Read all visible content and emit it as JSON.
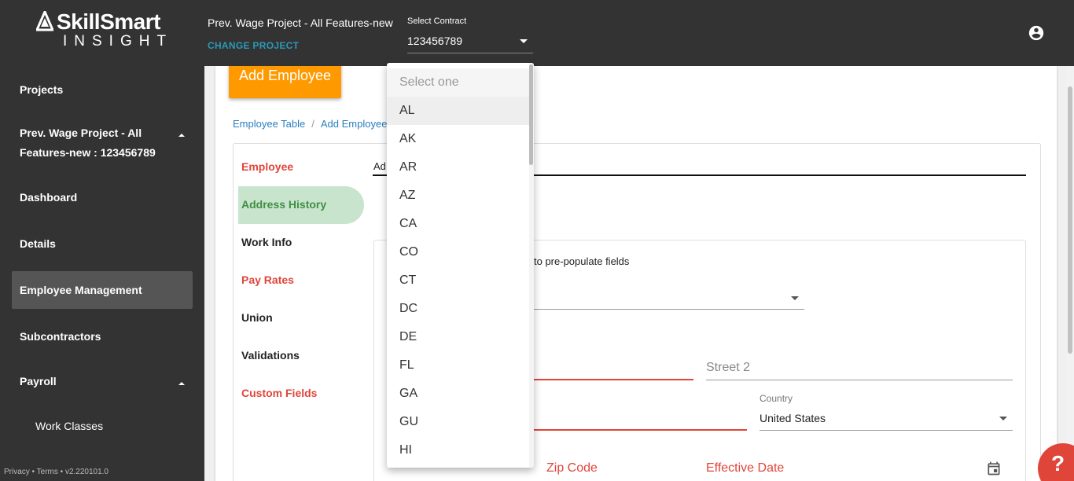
{
  "header": {
    "logo_line1": "SkillSmart",
    "logo_line2": "INSIGHT",
    "project_title": "Prev. Wage Project - All Features-new",
    "change_project": "CHANGE PROJECT",
    "contract_label": "Select Contract",
    "contract_value": "123456789",
    "user_icon": "account-circle-icon"
  },
  "sidebar": {
    "items": [
      {
        "label": "Projects"
      },
      {
        "label": "Prev. Wage Project - All"
      },
      {
        "label": "Features-new : 123456789"
      },
      {
        "label": "Dashboard"
      },
      {
        "label": "Details"
      },
      {
        "label": "Employee Management"
      },
      {
        "label": "Subcontractors"
      },
      {
        "label": "Payroll"
      },
      {
        "label": "Work Classes"
      }
    ],
    "footer": "Privacy • Terms • v2.220101.0"
  },
  "main": {
    "add_employee": "Add Employee",
    "breadcrumb": [
      "Employee Table",
      "Add Employee"
    ],
    "tabs": [
      {
        "label": "Employee"
      },
      {
        "label": "Address History"
      },
      {
        "label": "Work Info"
      },
      {
        "label": "Pay Rates"
      },
      {
        "label": "Union"
      },
      {
        "label": "Validations"
      },
      {
        "label": "Custom Fields"
      }
    ],
    "section_title": "Ad",
    "hint": "to pre-populate fields",
    "street2_placeholder": "Street 2",
    "country_label": "Country",
    "country_value": "United States",
    "zip_placeholder": "Zip Code",
    "effective_date_placeholder": "Effective Date"
  },
  "dropdown": {
    "placeholder": "Select one",
    "options": [
      "AL",
      "AK",
      "AR",
      "AZ",
      "CA",
      "CO",
      "CT",
      "DC",
      "DE",
      "FL",
      "GA",
      "GU",
      "HI"
    ]
  },
  "help": "?",
  "colors": {
    "accent_orange": "#ff9900",
    "error_red": "#e0453a",
    "active_green": "#3f8f45",
    "link_blue": "#2a7fbf",
    "topbar": "#333333"
  }
}
